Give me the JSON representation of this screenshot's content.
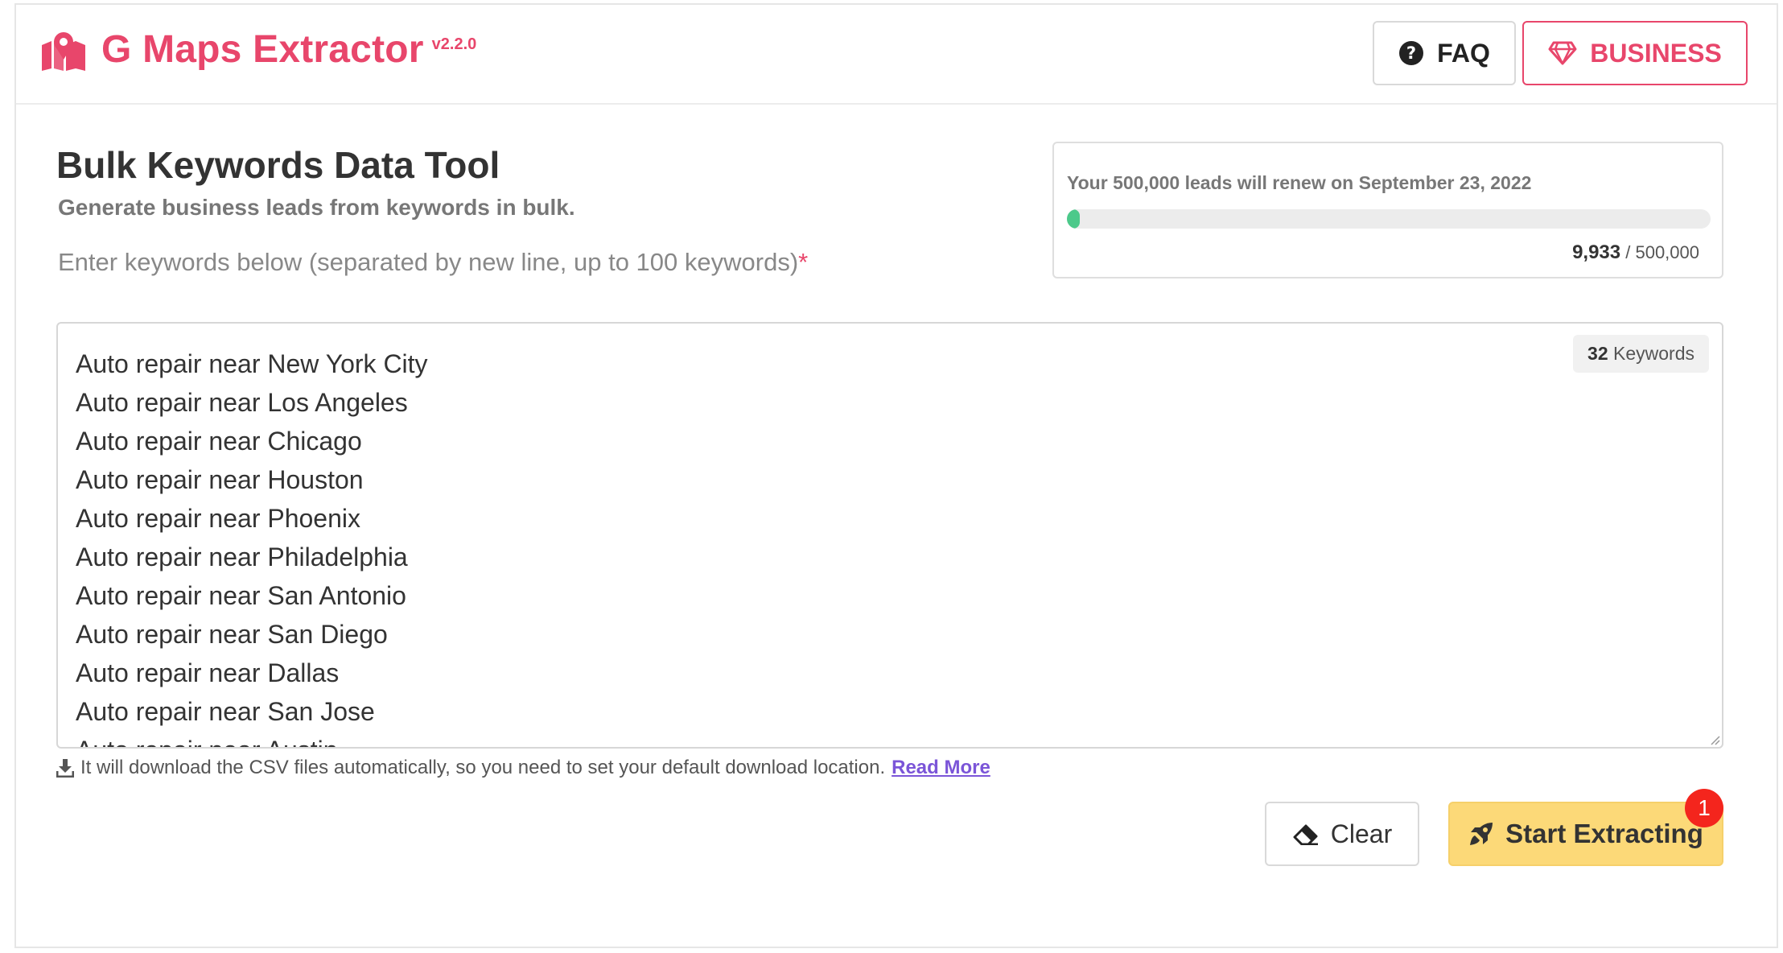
{
  "header": {
    "brand_title": "G Maps Extractor",
    "version": "v2.2.0",
    "faq_label": "FAQ",
    "business_label": "BUSINESS",
    "icons": {
      "brand": "map-pin-icon",
      "faq": "question-circle-icon",
      "business": "gem-icon"
    }
  },
  "main": {
    "title": "Bulk Keywords Data Tool",
    "subtitle": "Generate business leads from keywords in bulk.",
    "input_label": "Enter keywords below (separated by new line, up to 100 keywords)",
    "required_mark": "*"
  },
  "usage": {
    "renew_text": "Your 500,000 leads will renew on September 23, 2022",
    "used": "9,933",
    "total": "/ 500,000",
    "progress_fraction": 0.0199,
    "progress_color": "#4cc98a"
  },
  "keywords": {
    "count": "32",
    "count_suffix": "Keywords",
    "lines": [
      "Auto repair near New York City",
      "Auto repair near Los Angeles",
      "Auto repair near Chicago",
      "Auto repair near Houston",
      "Auto repair near Phoenix",
      "Auto repair near Philadelphia",
      "Auto repair near San Antonio",
      "Auto repair near San Diego",
      "Auto repair near Dallas",
      "Auto repair near San Jose",
      "Auto repair near Austin"
    ]
  },
  "helper": {
    "text": "It will download the CSV files automatically, so you need to set your default download location.",
    "link": "Read More",
    "icon": "download-icon"
  },
  "actions": {
    "clear_label": "Clear",
    "start_label": "Start Extracting",
    "notification_count": "1"
  },
  "colors": {
    "brand": "#e8466b",
    "start_button": "#fcd978",
    "link": "#7b55d8",
    "badge": "#f4251d"
  }
}
